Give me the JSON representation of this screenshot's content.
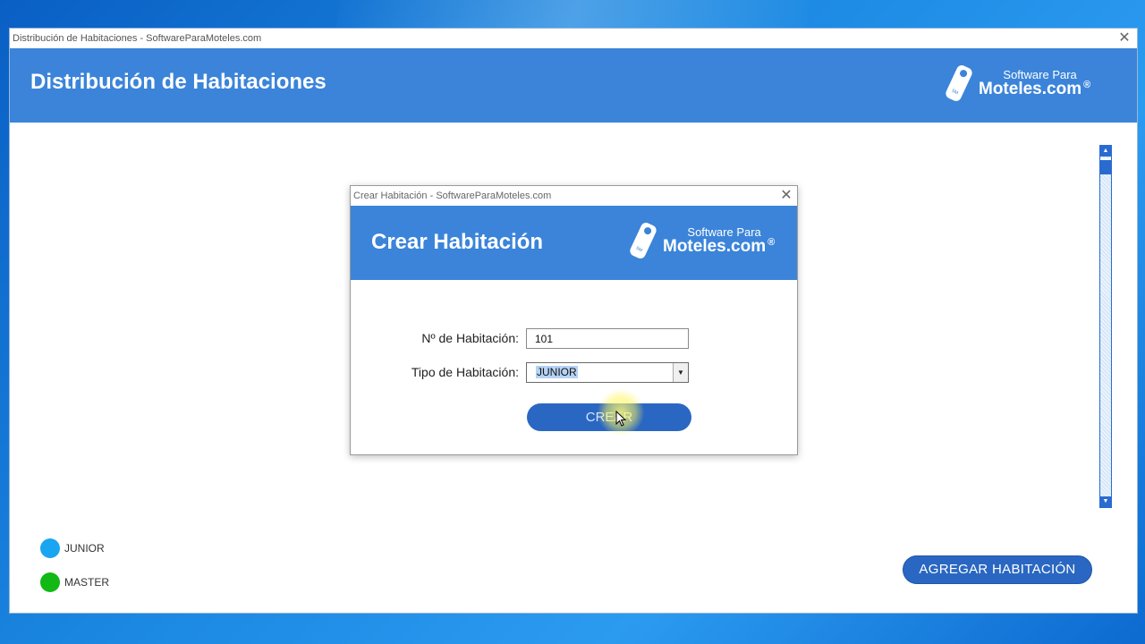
{
  "main_window": {
    "title": "Distribución de Habitaciones - SoftwareParaMoteles.com",
    "header_title": "Distribución de Habitaciones",
    "logo": {
      "line1": "Software Para",
      "line2": "Moteles.com",
      "mark": "®"
    }
  },
  "legend": [
    {
      "label": "JUNIOR",
      "color": "#1aa5f0"
    },
    {
      "label": "MASTER",
      "color": "#12b814"
    }
  ],
  "actions": {
    "add_room_label": "AGREGAR HABITACIÓN"
  },
  "dialog": {
    "title": "Crear Habitación - SoftwareParaMoteles.com",
    "header_title": "Crear Habitación",
    "logo": {
      "line1": "Software Para",
      "line2": "Moteles.com",
      "mark": "®"
    },
    "room_number_label": "Nº de Habitación:",
    "room_number_value": "101",
    "room_type_label": "Tipo de Habitación:",
    "room_type_value": "JUNIOR",
    "create_label": "CREAR"
  },
  "colors": {
    "header_blue": "#3b84d9",
    "button_blue": "#2a67c2"
  }
}
